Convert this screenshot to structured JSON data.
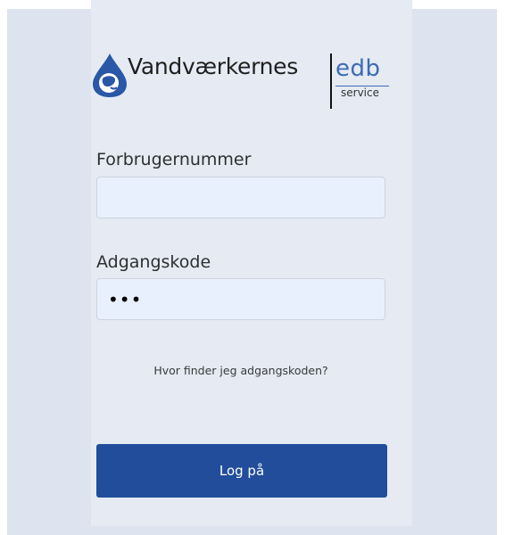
{
  "brand": {
    "wordmark": "Vandværkernes",
    "edb": "edb",
    "service": "service",
    "colors": {
      "edb_blue": "#3c6bb3",
      "drop_blue": "#2a57a6",
      "button_blue": "#214d9b"
    },
    "icon": "water-drop-logo-icon"
  },
  "form": {
    "username_label": "Forbrugernummer",
    "username_value": "",
    "password_label": "Adgangskode",
    "password_value": "abc",
    "help_link": "Hvor finder jeg adgangskoden?",
    "submit_label": "Log på"
  }
}
